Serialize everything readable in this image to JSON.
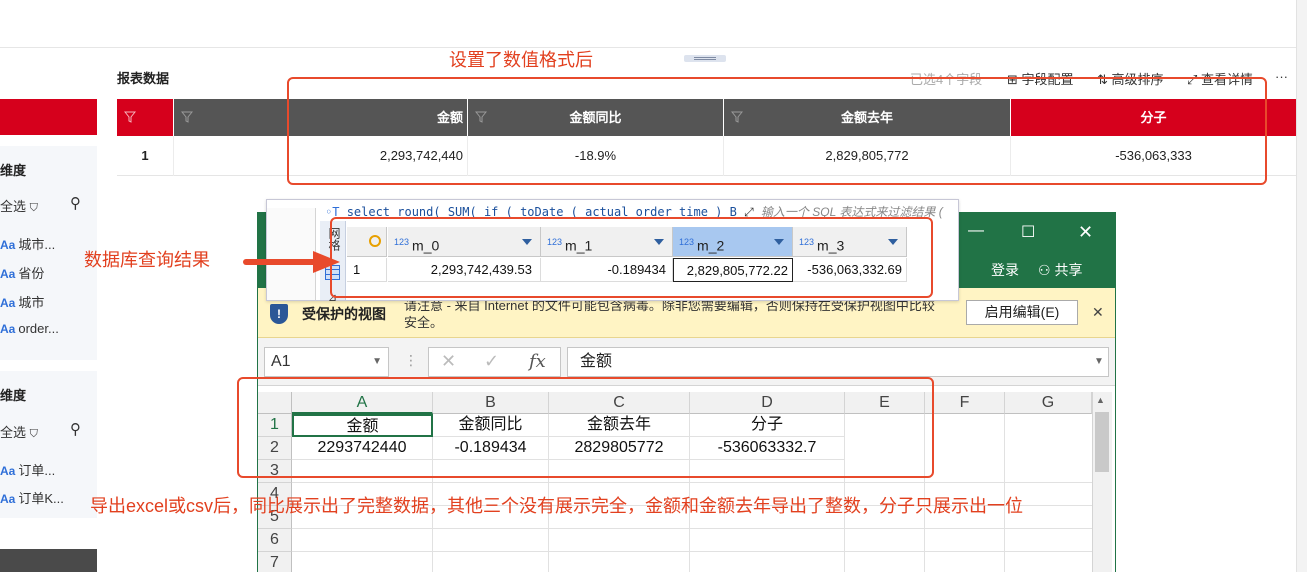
{
  "report": {
    "title": "报表数据",
    "toolbar": {
      "selected_fields": "已选4个字段",
      "field_config": "字段配置",
      "advanced_sort": "高级排序",
      "view_detail": "查看详情",
      "more": "···"
    },
    "columns": [
      "金额",
      "金额同比",
      "金额去年",
      "分子"
    ],
    "rows": [
      {
        "index": "1",
        "cells": [
          "2,293,742,440",
          "-18.9%",
          "2,829,805,772",
          "-536,063,333"
        ]
      }
    ]
  },
  "sidebar": {
    "panel1": {
      "title": "维度",
      "select_all": "全选",
      "items": [
        "城市...",
        "省份",
        "城市",
        "order..."
      ]
    },
    "panel2": {
      "title": "维度",
      "select_all": "全选",
      "items": [
        "订单...",
        "订单K..."
      ]
    }
  },
  "db": {
    "sql": "select round( SUM( if ( toDate ( actual_order_time ) B",
    "filter_placeholder": "输入一个 SQL 表达式来过滤结果 (",
    "side_label": "网格",
    "columns": [
      "m_0",
      "m_1",
      "m_2",
      "m_3"
    ],
    "row_index": "1",
    "values": [
      "2,293,742,439.53",
      "-0.189434",
      "2,829,805,772.22",
      "-536,063,332.69"
    ]
  },
  "excel": {
    "login": "登录",
    "share": "共享",
    "protected_view_title": "受保护的视图",
    "protected_view_message": "请注意 - 来自 Internet 的文件可能包含病毒。除非您需要编辑，否则保持在受保护视图中比较安全。",
    "enable_editing": "启用编辑(E)",
    "name_box": "A1",
    "formula_value": "金额",
    "columns": [
      "A",
      "B",
      "C",
      "D",
      "E",
      "F",
      "G"
    ],
    "rows": [
      "1",
      "2",
      "3",
      "4",
      "5",
      "6",
      "7"
    ],
    "header_row": [
      "金额",
      "金额同比",
      "金额去年",
      "分子"
    ],
    "data_row": [
      "2293742440",
      "-0.189434",
      "2829805772",
      "-536063332.7"
    ]
  },
  "annotations": {
    "top": "设置了数值格式后",
    "left": "数据库查询结果",
    "bottom": "导出excel或csv后，同比展示出了完整数据，其他三个没有展示完全，金额和金额去年导出了整数，分子只展示出一位"
  },
  "colors": {
    "brand_red": "#d6001c",
    "header_gray": "#555555",
    "excel_green": "#217346",
    "annotation_red": "#e84a2c"
  }
}
